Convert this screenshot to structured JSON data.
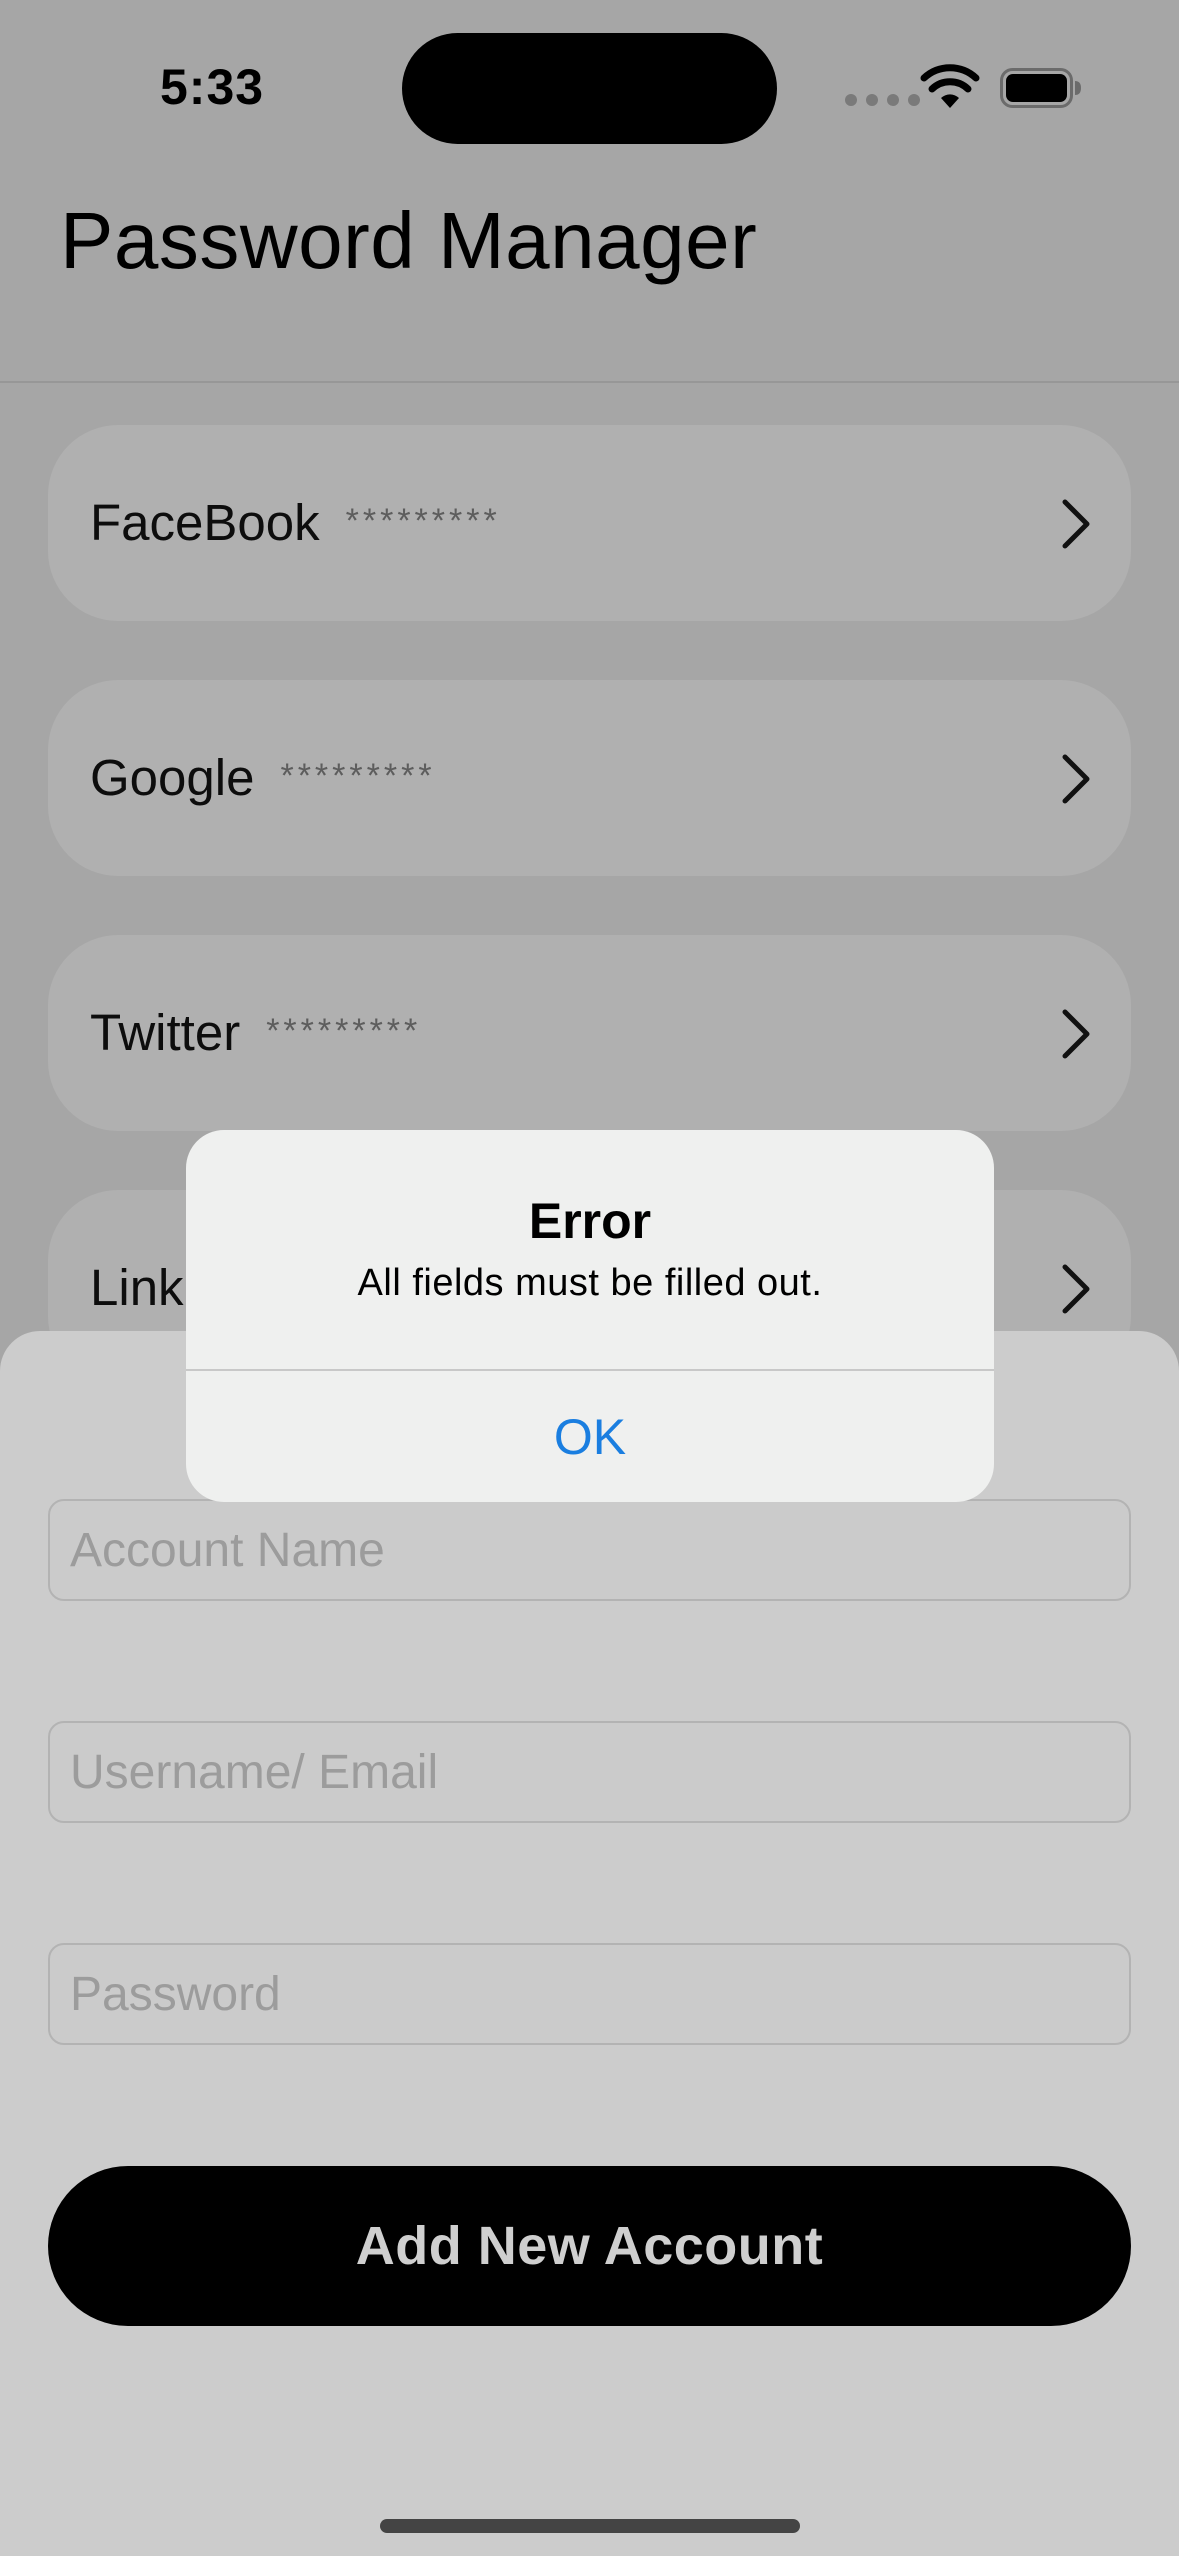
{
  "status_bar": {
    "time": "5:33"
  },
  "header": {
    "title": "Password Manager"
  },
  "accounts": [
    {
      "name": "FaceBook",
      "password_mask": "*********"
    },
    {
      "name": "Google",
      "password_mask": "*********"
    },
    {
      "name": "Twitter",
      "password_mask": "*********"
    },
    {
      "name": "Link"
    }
  ],
  "form": {
    "account_name_placeholder": "Account Name",
    "username_placeholder": "Username/ Email",
    "password_placeholder": "Password",
    "submit_label": "Add New Account"
  },
  "alert": {
    "title": "Error",
    "message": "All fields must be filled out.",
    "ok_label": "OK",
    "ok_color": "#1a7ee0"
  },
  "icons": {
    "chevron": "chevron-right-icon",
    "wifi": "wifi-icon",
    "battery": "battery-icon",
    "signal": "cellular-signal-icon"
  }
}
